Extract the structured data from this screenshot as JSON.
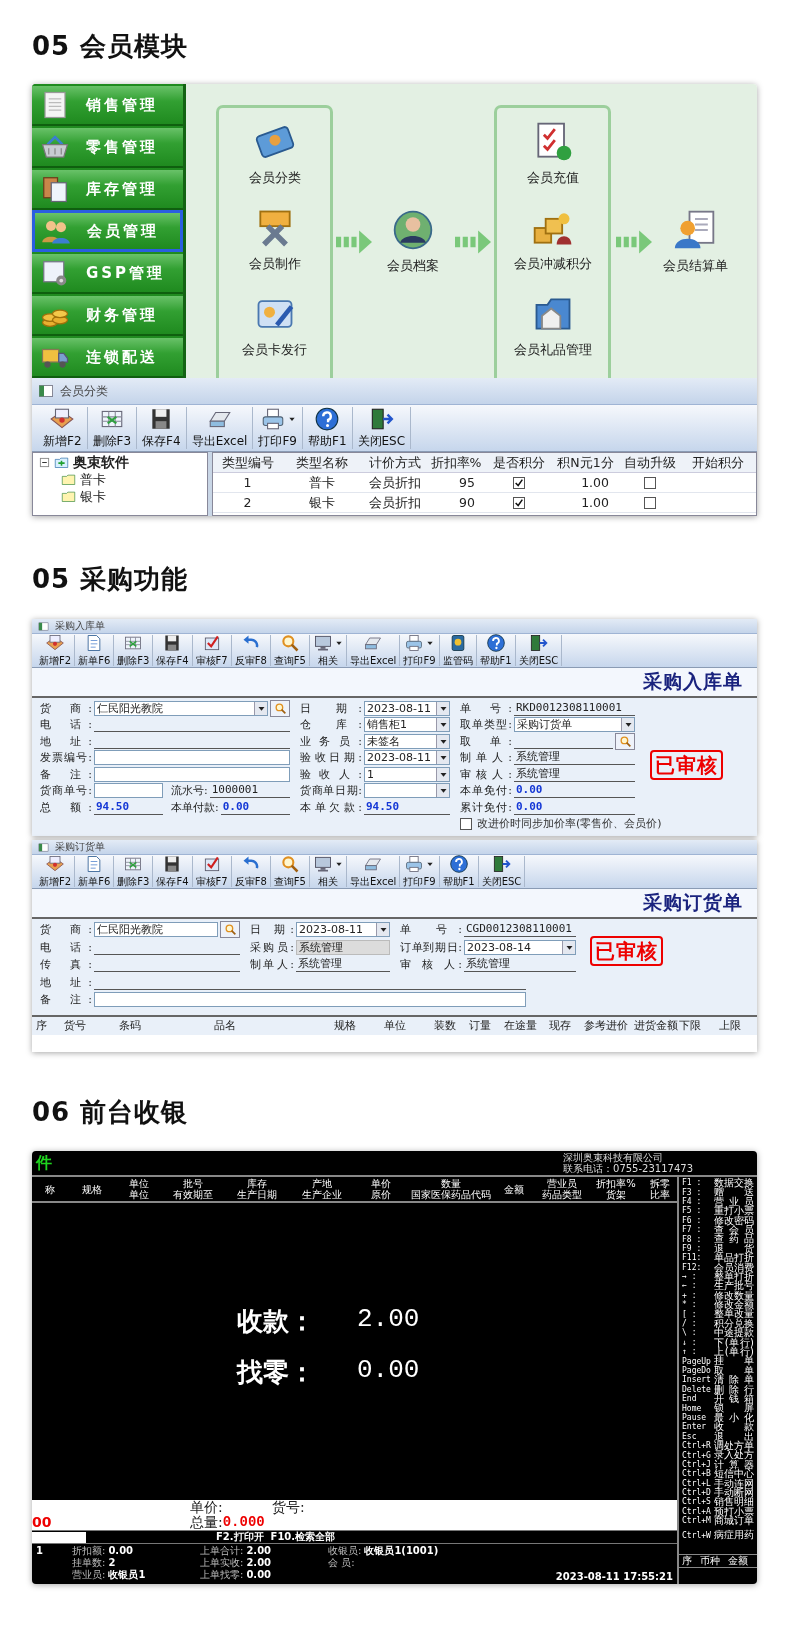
{
  "member_module": {
    "heading": "05 会员模块",
    "menu": [
      {
        "label": "销售管理",
        "selected": false
      },
      {
        "label": "零售管理",
        "selected": false
      },
      {
        "label": "库存管理",
        "selected": false
      },
      {
        "label": "会员管理",
        "selected": true
      },
      {
        "label": "GSP管理",
        "selected": false
      },
      {
        "label": "财务管理",
        "selected": false
      },
      {
        "label": "连锁配送",
        "selected": false
      }
    ],
    "flow": {
      "group_1": [
        "会员分类",
        "会员制作",
        "会员卡发行"
      ],
      "center": "会员档案",
      "group_2": [
        "会员充值",
        "会员冲减积分",
        "会员礼品管理"
      ],
      "end": "会员结算单"
    },
    "window": {
      "title": "会员分类",
      "toolbar": [
        {
          "label": "新增F2",
          "has_menu": false
        },
        {
          "label": "删除F3",
          "has_menu": false
        },
        {
          "label": "保存F4",
          "has_menu": false
        },
        {
          "label": "导出Excel",
          "has_menu": false
        },
        {
          "label": "打印F9",
          "has_menu": true
        },
        {
          "label": "帮助F1",
          "has_menu": false
        },
        {
          "label": "关闭ESC",
          "has_menu": false
        }
      ],
      "tree": {
        "label": "奥束软件",
        "expanded": true,
        "children": [
          {
            "label": "普卡"
          },
          {
            "label": "银卡"
          }
        ]
      },
      "table": {
        "columns": [
          "类型编号",
          "类型名称",
          "计价方式",
          "折扣率%",
          "是否积分",
          "积N元1分",
          "自动升级",
          "开始积分"
        ],
        "rows": [
          {
            "code": "1",
            "name": "普卡",
            "pricing": "会员折扣",
            "discount": "95",
            "points": true,
            "per_yuan": "1.00",
            "auto_upgrade": false
          },
          {
            "code": "2",
            "name": "银卡",
            "pricing": "会员折扣",
            "discount": "90",
            "points": true,
            "per_yuan": "1.00",
            "auto_upgrade": false
          }
        ]
      }
    }
  },
  "purchase": {
    "heading": "05 采购功能",
    "receipt": {
      "title": "采购入库单",
      "toolbar": [
        {
          "label": "新增F2",
          "has_menu": false
        },
        {
          "label": "新单F6",
          "has_menu": false
        },
        {
          "label": "删除F3",
          "has_menu": false
        },
        {
          "label": "保存F4",
          "has_menu": false
        },
        {
          "label": "审核F7",
          "has_menu": false
        },
        {
          "label": "反审F8",
          "has_menu": false
        },
        {
          "label": "查询F5",
          "has_menu": false
        },
        {
          "label": "相关",
          "has_menu": true
        },
        {
          "label": "导出Excel",
          "has_menu": false
        },
        {
          "label": "打印F9",
          "has_menu": true
        },
        {
          "label": "监管码",
          "has_menu": false
        },
        {
          "label": "帮助F1",
          "has_menu": false
        },
        {
          "label": "关闭ESC",
          "has_menu": false
        }
      ],
      "doc_title": "采购入库单",
      "form": {
        "stamp": "已审核",
        "columns": [
          [
            [
              {
                "label": "货 商:",
                "kind": "combo",
                "value": "仁民阳光教院",
                "search": true
              }
            ],
            [
              {
                "label": "电 话:",
                "kind": "line"
              }
            ],
            [
              {
                "label": "地 址:",
                "kind": "line"
              }
            ],
            [
              {
                "label": "发票编号:",
                "kind": "input"
              }
            ],
            [
              {
                "label": "备 注:",
                "kind": "input"
              }
            ],
            [
              {
                "label": "货商单号:",
                "kind": "input"
              },
              {
                "label": "流水号:",
                "kind": "line",
                "value": "1000001"
              }
            ],
            [
              {
                "label": "总 额:",
                "kind": "amount",
                "value": "94.50"
              },
              {
                "label": "本单付款:",
                "kind": "amount",
                "value": "0.00"
              }
            ]
          ],
          [
            [
              {
                "label": "日 期:",
                "kind": "combo",
                "value": "2023-08-11"
              }
            ],
            [
              {
                "label": "仓 库:",
                "kind": "combo",
                "value": "销售柜1"
              }
            ],
            [
              {
                "label": "业务员:",
                "kind": "combo",
                "value": "未签名"
              }
            ],
            [
              {
                "label": "验收日期:",
                "kind": "combo",
                "value": "2023-08-11"
              }
            ],
            [
              {
                "label": "验收人:",
                "kind": "combo",
                "value": "1"
              }
            ],
            [
              {
                "label": "货商单日期:",
                "kind": "combo"
              }
            ],
            [
              {
                "label": "本单欠款:",
                "kind": "amount",
                "value": "94.50"
              }
            ]
          ],
          [
            [
              {
                "label": "单 号:",
                "kind": "line",
                "value": "RKD0012308110001"
              }
            ],
            [
              {
                "label": "取单类型:",
                "kind": "combo",
                "value": "采购订货单"
              }
            ],
            [
              {
                "label": "取 单:",
                "kind": "line",
                "search": true
              }
            ],
            [
              {
                "label": "制单人:",
                "kind": "line",
                "value": "系统管理"
              }
            ],
            [
              {
                "label": "审核人:",
                "kind": "line",
                "value": "系统管理"
              }
            ],
            [
              {
                "label": "本单免付:",
                "kind": "amount",
                "value": "0.00"
              }
            ],
            [
              {
                "label": "累计免付:",
                "kind": "amount",
                "value": "0.00"
              }
            ],
            [
              {
                "label": "改进价时同步加价率(零售价、会员价)",
                "kind": "checkbox",
                "checked": false
              }
            ]
          ]
        ]
      }
    },
    "order": {
      "title": "采购订货单",
      "toolbar": [
        {
          "label": "新增F2",
          "has_menu": false
        },
        {
          "label": "新单F6",
          "has_menu": false
        },
        {
          "label": "删除F3",
          "has_menu": false
        },
        {
          "label": "保存F4",
          "has_menu": false
        },
        {
          "label": "审核F7",
          "has_menu": false
        },
        {
          "label": "反审F8",
          "has_menu": false
        },
        {
          "label": "查询F5",
          "has_menu": false
        },
        {
          "label": "相关",
          "has_menu": true
        },
        {
          "label": "导出Excel",
          "has_menu": false
        },
        {
          "label": "打印F9",
          "has_menu": true
        },
        {
          "label": "帮助F1",
          "has_menu": false
        },
        {
          "label": "关闭ESC",
          "has_menu": false
        }
      ],
      "doc_title": "采购订货单",
      "form": {
        "stamp": "已审核",
        "columns": [
          [
            [
              {
                "label": "货 商:",
                "kind": "input",
                "value": "仁民阳光教院",
                "search": true
              }
            ],
            [
              {
                "label": "电 话:",
                "kind": "line"
              }
            ],
            [
              {
                "label": "传 真:",
                "kind": "line"
              }
            ]
          ],
          [
            [
              {
                "label": "日 期:",
                "kind": "combo",
                "value": "2023-08-11"
              }
            ],
            [
              {
                "label": "采购员:",
                "kind": "readonly",
                "value": "系统管理"
              }
            ],
            [
              {
                "label": "制单人:",
                "kind": "line",
                "value": "系统管理"
              }
            ]
          ],
          [
            [
              {
                "label": "单 号:",
                "kind": "line",
                "value": "CGD0012308110001"
              }
            ],
            [
              {
                "label": "订单到期日:",
                "kind": "combo",
                "value": "2023-08-14"
              }
            ],
            [
              {
                "label": "审 核 人:",
                "kind": "line",
                "value": "系统管理"
              }
            ]
          ]
        ],
        "wide_rows": [
          [
            {
              "label": "地 址:",
              "kind": "line"
            }
          ],
          [
            {
              "label": "备 注:",
              "kind": "input"
            }
          ]
        ]
      },
      "table_columns": [
        "序",
        "货号",
        "条码",
        "品名",
        "规格",
        "单位",
        "装数",
        "订量",
        "在途量",
        "现存",
        "参考进价",
        "进货金额",
        "下限",
        "上限"
      ]
    }
  },
  "checkout": {
    "heading": "06 前台收银",
    "title": "件",
    "company": "深圳奥束科技有限公司",
    "phone": "联系电话：0755-23117473",
    "columns": [
      [
        "称"
      ],
      [
        "规格"
      ],
      [
        "单位",
        "单位"
      ],
      [
        "批号",
        "有效期至"
      ],
      [
        "库存",
        "生产日期"
      ],
      [
        "产地",
        "生产企业"
      ],
      [
        "单价",
        "原价"
      ],
      [
        "数量",
        "国家医保药品代码"
      ],
      [
        "金额"
      ],
      [
        "营业员",
        "药品类型"
      ],
      [
        "折扣率%",
        "货架"
      ],
      [
        "拆零",
        "比率"
      ]
    ],
    "payment": [
      {
        "label": "收款：",
        "value": "2.00"
      },
      {
        "label": "找零：",
        "value": "0.00"
      }
    ],
    "shortcut_groups": [
      [
        {
          "key": "F1 :",
          "action": "数据交换"
        },
        {
          "key": "F3 :",
          "action": "赠 送"
        },
        {
          "key": "F4 :",
          "action": "营业员"
        },
        {
          "key": "F5 :",
          "action": "重打小票"
        },
        {
          "key": "F6 :",
          "action": "修改密码"
        },
        {
          "key": "F7 :",
          "action": "查会员"
        },
        {
          "key": "F8 :",
          "action": "查药品"
        },
        {
          "key": "F9 :",
          "action": "退 货"
        },
        {
          "key": "F11:",
          "action": "单品打折"
        },
        {
          "key": "F12:",
          "action": "会员消费"
        },
        {
          "key": "→ :",
          "action": "整单打折"
        },
        {
          "key": "← :",
          "action": "生产批号"
        },
        {
          "key": "+ :",
          "action": "修改数量"
        },
        {
          "key": "* :",
          "action": "修改金额"
        },
        {
          "key": "[ :",
          "action": "整单改量"
        },
        {
          "key": "/ :",
          "action": "积分兑换"
        },
        {
          "key": "\\ :",
          "action": "中途提款"
        },
        {
          "key": "↓ :",
          "action": "下(单行)"
        },
        {
          "key": "↑ :",
          "action": "上(单行)"
        },
        {
          "key": "PageUp",
          "action": "挂 单"
        },
        {
          "key": "PageDo",
          "action": "取 单"
        },
        {
          "key": "Insert",
          "action": "清除单"
        },
        {
          "key": "Delete",
          "action": "删除行"
        },
        {
          "key": "End",
          "action": "开钱箱"
        },
        {
          "key": "Home",
          "action": "锁 屏"
        },
        {
          "key": "Pause",
          "action": "最小化"
        },
        {
          "key": "Enter",
          "action": "收 款"
        },
        {
          "key": "Esc",
          "action": "退 出"
        },
        {
          "key": "Ctrl+R",
          "action": "调处方单"
        },
        {
          "key": "Ctrl+G",
          "action": "录入处方"
        },
        {
          "key": "Ctrl+J",
          "action": "计算器"
        },
        {
          "key": "Ctrl+B",
          "action": "短信中心"
        },
        {
          "key": "Ctrl+L",
          "action": "手动连网"
        },
        {
          "key": "Ctrl+D",
          "action": "手动断网"
        },
        {
          "key": "Ctrl+S",
          "action": "销售明细"
        },
        {
          "key": "Ctrl+A",
          "action": "预打小票"
        },
        {
          "key": "Ctrl+M",
          "action": "商城订单"
        }
      ],
      [
        {
          "key": "Ctrl+W",
          "action": "病症用药"
        }
      ]
    ],
    "entry": {
      "amount": "00",
      "unit_price_label": "单价:",
      "item_no_label": "货号:",
      "total_label": "总量:",
      "total": "0.000"
    },
    "hint": "F2.打印开  F10.检索全部",
    "side_footer": [
      "序",
      "币种",
      "金额"
    ],
    "summary": {
      "lead": "1",
      "columns": [
        [
          {
            "label": "折扣额:",
            "value": "0.00"
          },
          {
            "label": "挂单数:",
            "value": "2"
          },
          {
            "label": "营业员:",
            "value": "收银员1"
          }
        ],
        [
          {
            "label": "上单合计:",
            "value": "2.00"
          },
          {
            "label": "上单实收:",
            "value": "2.00"
          },
          {
            "label": "上单找零:",
            "value": "0.00"
          }
        ],
        [
          {
            "label": "收银员:",
            "value": "收银员1(1001)"
          },
          {
            "label": "会 员:"
          }
        ]
      ]
    },
    "timestamp": "2023-08-11 17:55:21"
  }
}
